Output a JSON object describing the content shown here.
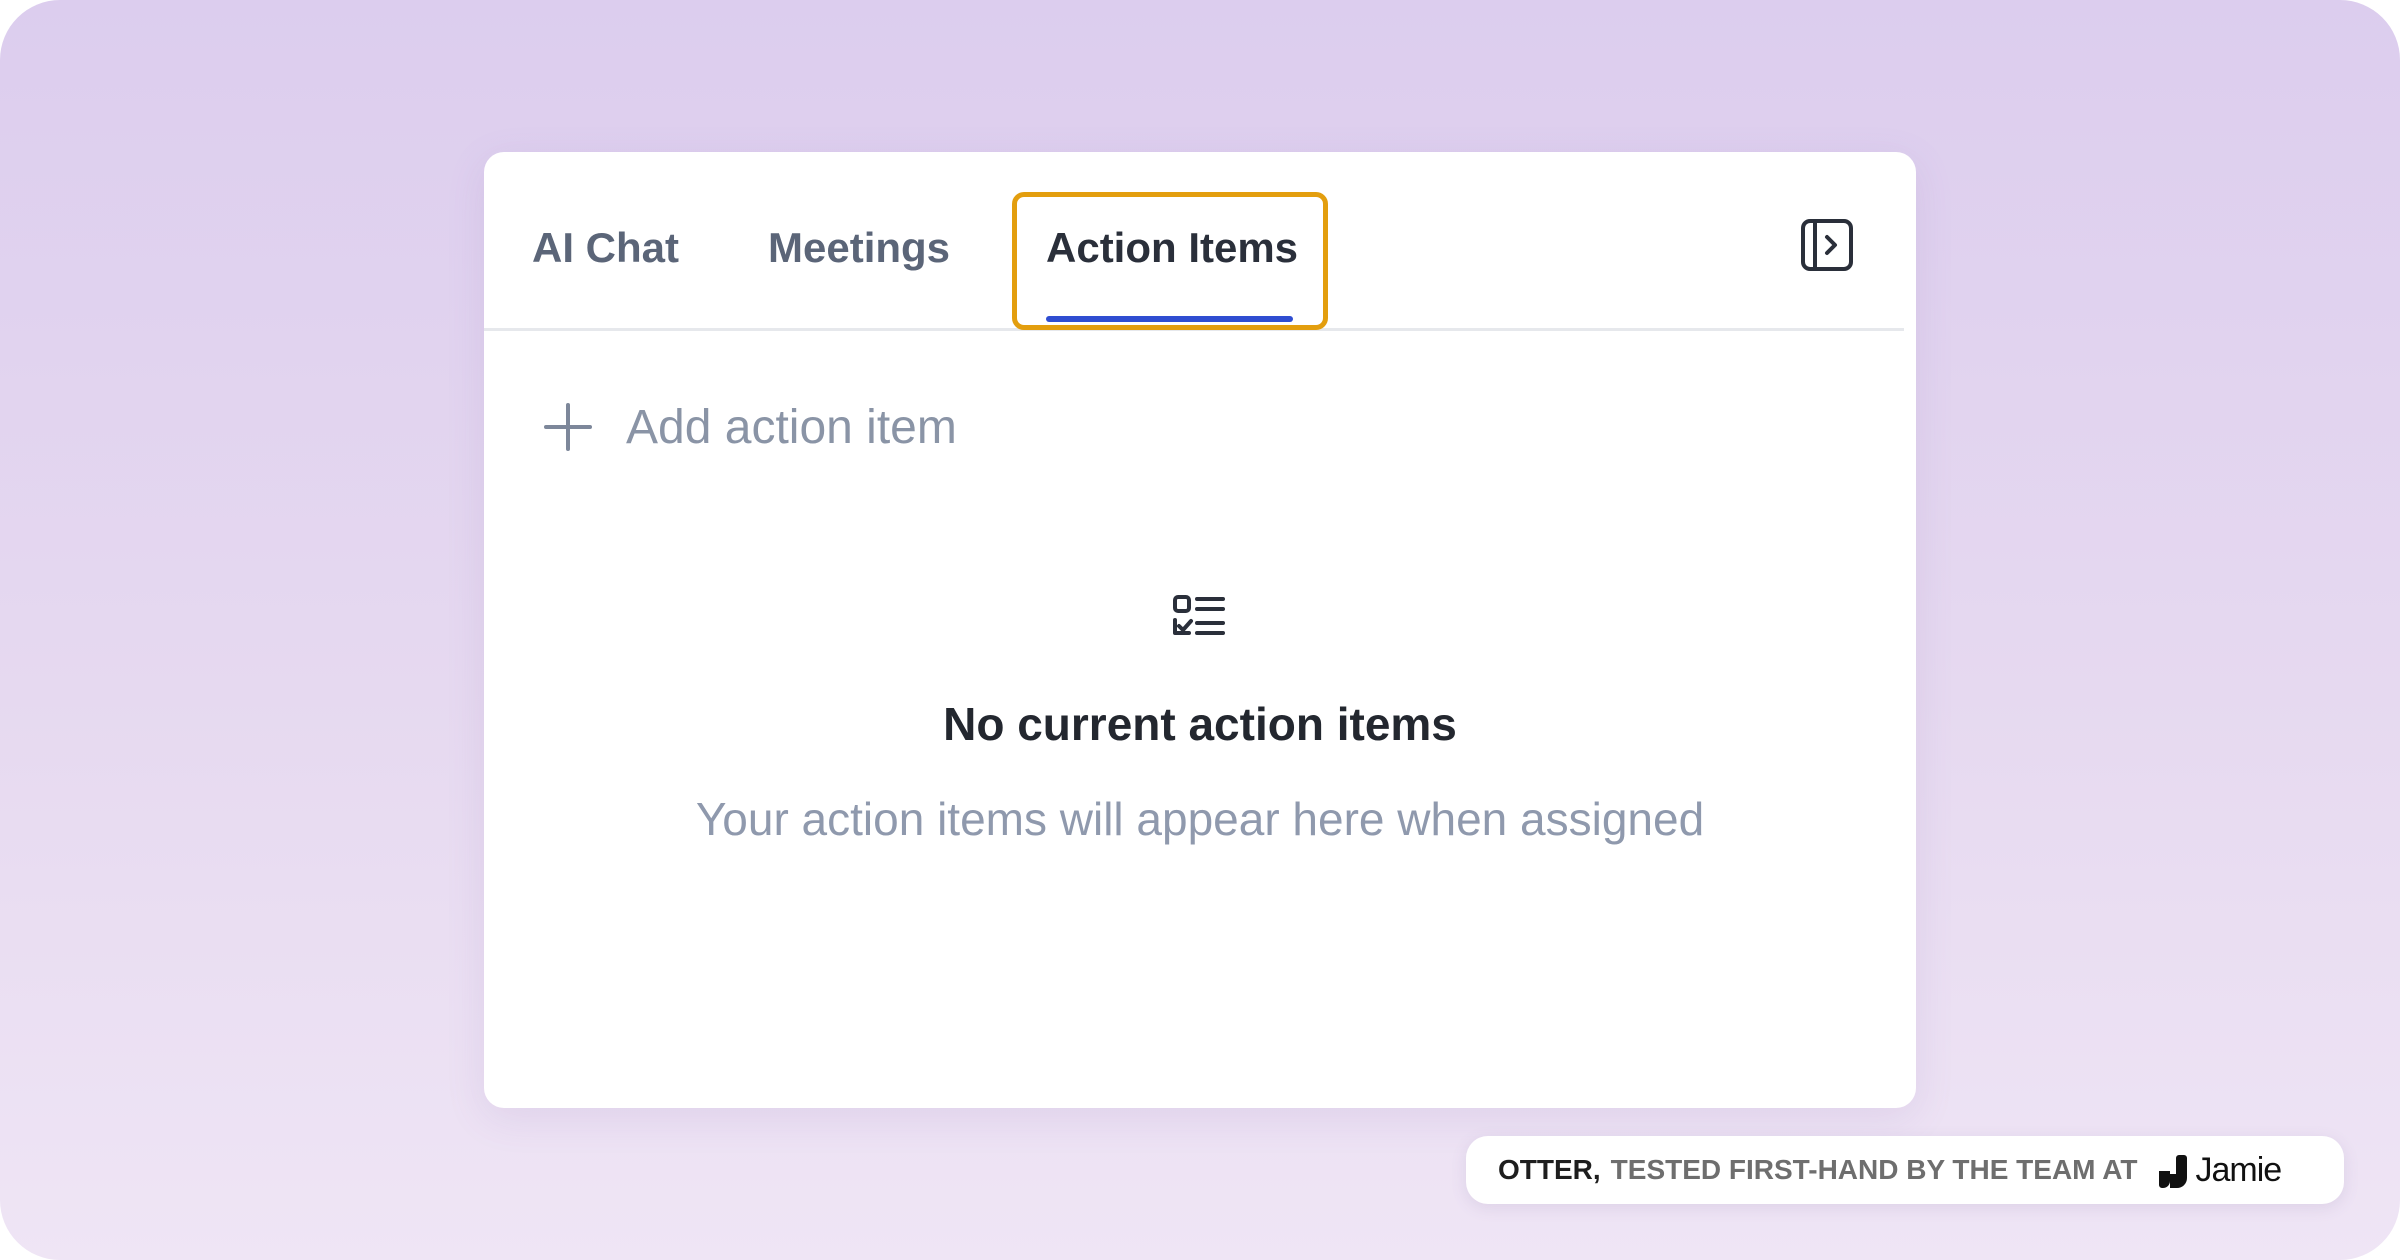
{
  "tabs": [
    {
      "label": "AI Chat"
    },
    {
      "label": "Meetings"
    },
    {
      "label": "Action Items",
      "active": true
    }
  ],
  "icons": {
    "collapse": "sidebar-collapse-icon",
    "add": "plus-icon",
    "empty": "checklist-icon"
  },
  "add_action": {
    "label": "Add action item"
  },
  "empty_state": {
    "title": "No current action items",
    "subtitle": "Your action items will appear here when assigned"
  },
  "badge": {
    "strong": "OTTER,",
    "rest": "TESTED FIRST-HAND BY THE TEAM AT",
    "brand": "Jamie"
  },
  "colors": {
    "active_tab_underline": "#2f4dd1",
    "highlight_border": "#e39e0e",
    "background": "#dccdee"
  }
}
